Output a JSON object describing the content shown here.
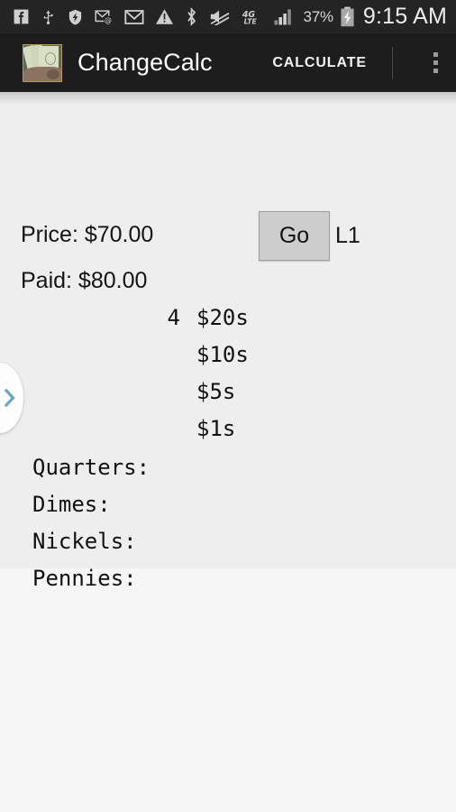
{
  "statusbar": {
    "icons": [
      {
        "name": "facebook-icon"
      },
      {
        "name": "usb-icon"
      },
      {
        "name": "shield-security-icon"
      },
      {
        "name": "email-at-icon"
      },
      {
        "name": "gmail-icon"
      },
      {
        "name": "warning-triangle-icon"
      },
      {
        "name": "bluetooth-icon"
      },
      {
        "name": "volume-muted-icon"
      },
      {
        "name": "4g-lte-icon"
      },
      {
        "name": "signal-bars-icon"
      }
    ],
    "battery_percent": "37%",
    "battery_icon": "battery-charging-icon",
    "clock": "9:15 AM",
    "network_label": "4G",
    "network_sublabel": "LTE"
  },
  "appbar": {
    "app_icon_name": "changecalc-app-icon",
    "title": "ChangeCalc",
    "action_label": "CALCULATE",
    "overflow_icon": "overflow-menu-icon"
  },
  "main": {
    "price_line": "Price: $70.00",
    "paid_line": "Paid: $80.00",
    "go_button_label": "Go",
    "l1_label": "L1",
    "bills": [
      {
        "count": "4",
        "label": "$20s"
      },
      {
        "count": "",
        "label": "$10s"
      },
      {
        "count": "",
        "label": "$5s"
      },
      {
        "count": "",
        "label": "$1s"
      }
    ],
    "coins": [
      {
        "label": "Quarters:",
        "count": ""
      },
      {
        "label": "Dimes:",
        "count": ""
      },
      {
        "label": "Nickels:",
        "count": ""
      },
      {
        "label": "Pennies:",
        "count": ""
      }
    ]
  },
  "drawer": {
    "tab_icon": "chevron-right-icon",
    "tab_color": "#6aa6c0"
  },
  "colors": {
    "statusbar_bg": "#242424",
    "appbar_bg": "#1d1d1d",
    "content_bg": "#eeeeee",
    "button_bg": "#cdcdcd",
    "accent": "#6aa6c0"
  }
}
